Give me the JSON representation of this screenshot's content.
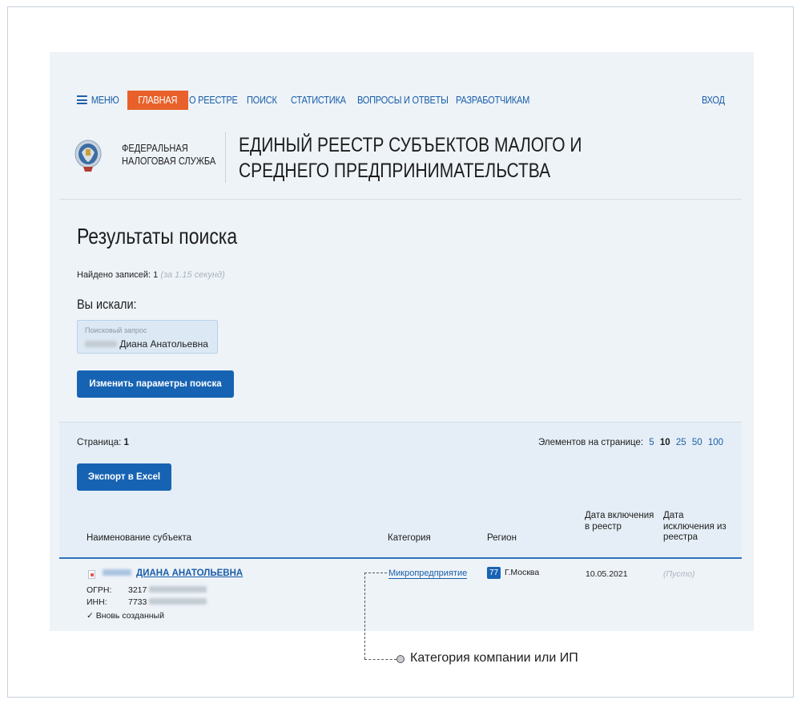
{
  "nav": {
    "menu": "МЕНЮ",
    "home": "ГЛАВНАЯ",
    "items": [
      "О РЕЕСТРЕ",
      "ПОИСК",
      "СТАТИСТИКА",
      "ВОПРОСЫ И ОТВЕТЫ",
      "РАЗРАБОТЧИКАМ"
    ],
    "login": "ВХОД",
    "home_color": "#e8612a",
    "link_color": "#1a5ea8"
  },
  "brand": {
    "agency_line1": "ФЕДЕРАЛЬНАЯ",
    "agency_line2": "НАЛОГОВАЯ СЛУЖБА",
    "registry_title": "ЕДИНЫЙ РЕЕСТР СУБЪЕКТОВ МАЛОГО И СРЕДНЕГО ПРЕДПРИНИМАТЕЛЬСТВА",
    "emblem": "fns-emblem-icon"
  },
  "results": {
    "title": "Результаты поиска",
    "found_label": "Найдено записей:",
    "found_count": "1",
    "found_time": "(за 1.15 секунд)",
    "you_searched": "Вы искали:",
    "query_label": "Поисковый запрос",
    "query_value": "Диана Анатольевна",
    "change_button": "Изменить параметры поиска"
  },
  "table": {
    "page_label": "Страница:",
    "page_number": "1",
    "per_page_label": "Элементов на странице:",
    "per_page_options": [
      "5",
      "10",
      "25",
      "50",
      "100"
    ],
    "per_page_selected": "10",
    "export_button": "Экспорт в Excel",
    "headers": {
      "name": "Наименование субъекта",
      "category": "Категория",
      "region": "Регион",
      "inclusion_date": "Дата включения в реестр",
      "exclusion_date": "Дата исключения из реестра"
    },
    "rows": [
      {
        "name": "ДИАНА АНАТОЛЬЕВНА",
        "ogrn_label": "ОГРН:",
        "ogrn_prefix": "3217",
        "inn_label": "ИНН:",
        "inn_prefix": "7733",
        "status": "✓ Вновь созданный",
        "category": "Микропредприятие",
        "region_code": "77",
        "region_name": "Г.Москва",
        "inclusion_date": "10.05.2021",
        "exclusion_date": "(Пусто)"
      }
    ]
  },
  "annotation": {
    "text": "Категория компании или ИП"
  }
}
